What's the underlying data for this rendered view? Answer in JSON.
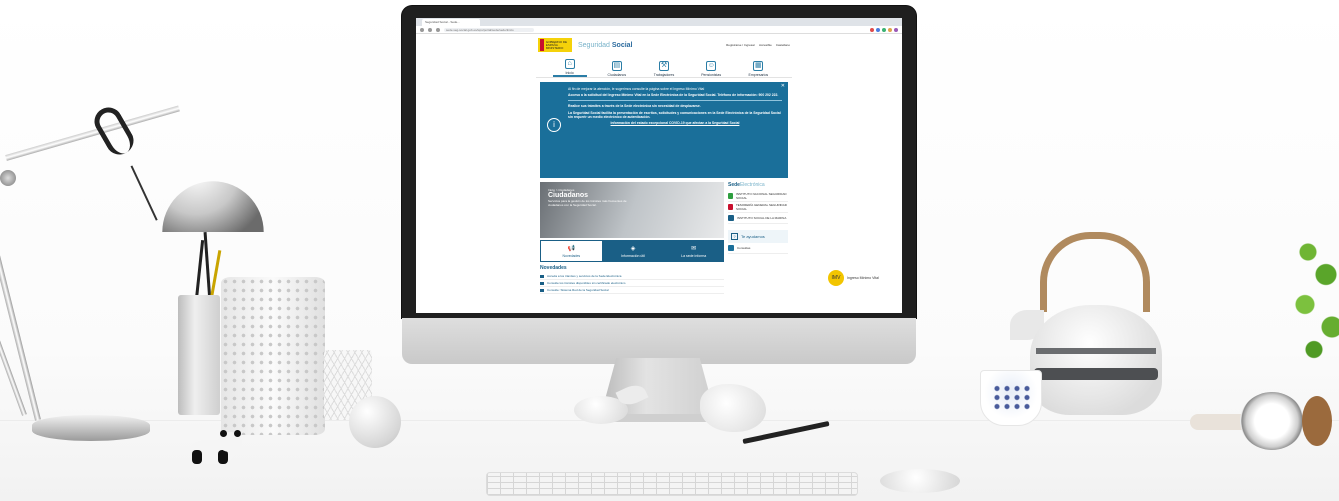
{
  "browser": {
    "tab_title": "Seguridad Social - Sede...",
    "url": "sede.seg-social.gob.es/wps/portal/sede/sede/Inicio"
  },
  "site": {
    "gov_logo_text": "GOBIERNO DE ESPAÑA · MINISTERIO",
    "brand_prefix": "Seguridad",
    "brand_suffix": "Social",
    "header_links": [
      "Registrarse / Ingresar",
      "Accesible",
      "Castellano"
    ],
    "nav": [
      {
        "label": "Inicio",
        "icon": "home-icon"
      },
      {
        "label": "Ciudadanos",
        "icon": "document-icon"
      },
      {
        "label": "Trabajadores",
        "icon": "tools-icon"
      },
      {
        "label": "Pensionistas",
        "icon": "person-icon"
      },
      {
        "label": "Empresarios",
        "icon": "building-icon"
      }
    ],
    "banner": {
      "p1": "Al fin de mejorar la atención, le sugerimos consulte la página sobre el Ingreso Mínimo Vital",
      "p2": "Acceso a la solicitud del Ingreso Mínimo Vital en la Sede Electrónica de la Seguridad Social. Teléfono de información: 900 202 222.",
      "p3": "Realice sus trámites a través de la Sede electrónica sin necesidad de desplazarse.",
      "p4": "La Seguridad Social facilita la presentación de escritos, solicitudes y comunicaciones en la Sede Electrónica de la Seguridad Social sin requerir un medio electrónico de autenticación.",
      "link": "Información del estado excepcional COVID-19 que afectan a la Seguridad Social"
    },
    "hero": {
      "small": "Inicio > Ciudadanos",
      "title": "Ciudadanos",
      "desc": "Servicios para la gestión de los trámites más frecuentes de ciudadanos con la Seguridad Social."
    },
    "tabs": [
      {
        "label": "Novedades",
        "icon": "megaphone-icon"
      },
      {
        "label": "Información útil",
        "icon": "info-icon"
      },
      {
        "label": "La sede informa",
        "icon": "chat-icon"
      }
    ],
    "news_title": "Novedades",
    "news": [
      "Acceda a los trámites y servicios de la Sede Electrónica",
      "Consulte los trámites disponibles sin certificado electrónico",
      "Consulte: Sistema Red de la Seguridad Social"
    ],
    "sede_prefix": "Sede",
    "sede_suffix": "Electrónica",
    "sede_items": [
      {
        "label": "INSTITUTO NACIONAL SEGURIDAD SOCIAL",
        "color": "#2e9e3f"
      },
      {
        "label": "TESORERÍA GENERAL SEGURIDAD SOCIAL",
        "color": "#c8102e"
      },
      {
        "label": "INSTITUTO SOCIAL DE LA MARINA",
        "color": "#1a5f86"
      }
    ],
    "help_label": "Te ayudamos",
    "help_sub": "Consultas",
    "promo_badge": "IMV",
    "promo_text": "Ingreso Mínimo Vital"
  },
  "colors": {
    "banner": "#1a6f9a",
    "brand": "#2b6b9e",
    "gov_yellow": "#f5d20a",
    "gov_red": "#c8102e"
  }
}
